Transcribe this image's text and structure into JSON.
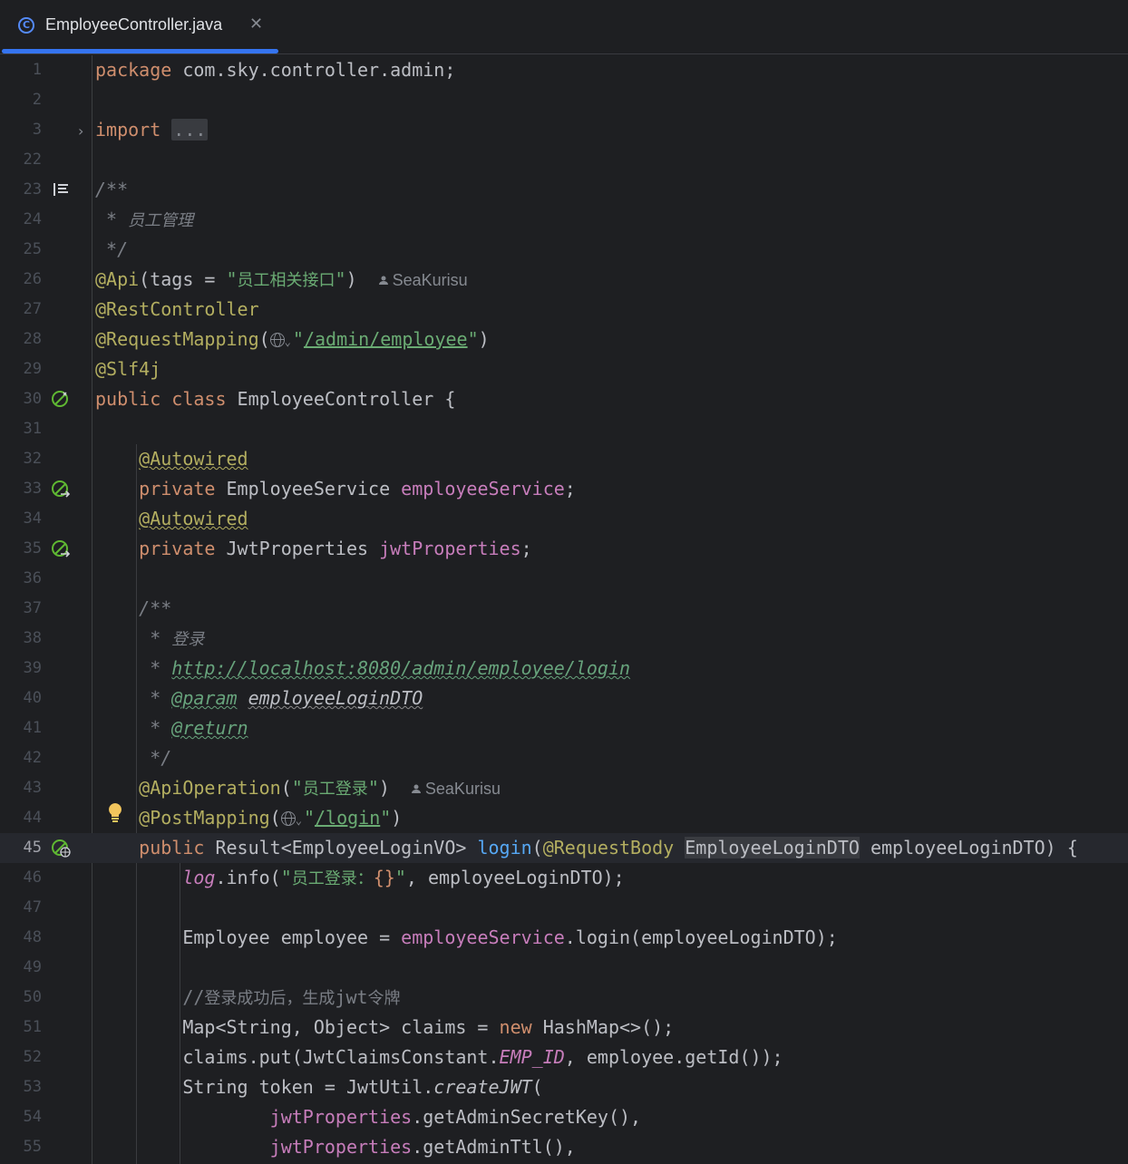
{
  "tab": {
    "icon": "class-icon",
    "label": "EmployeeController.java",
    "close": "✕"
  },
  "author": "SeaKurisu",
  "current_line": 45,
  "lines": [
    {
      "n": "1",
      "html": "<span class=\"kw\">package</span> com.sky.controller.admin;"
    },
    {
      "n": "2",
      "html": ""
    },
    {
      "n": "3",
      "html": "<span class=\"kw\">import</span> <span class=\"fold\">...</span>",
      "fold": true
    },
    {
      "n": "22",
      "html": ""
    },
    {
      "n": "23",
      "html": "<span class=\"cmt\">/**</span>",
      "icon": "reader-mode-icon"
    },
    {
      "n": "24",
      "html": "<span class=\"cmt\"> * <span class=\"cjk\">员工管理</span></span>"
    },
    {
      "n": "25",
      "html": "<span class=\"cmt\"> */</span>"
    },
    {
      "n": "26",
      "html": "<span class=\"ann\">@Api</span>(tags = <span class=\"str\">\"<span class=\"cjk\">员工相关接口</span>\"</span>)",
      "author": true
    },
    {
      "n": "27",
      "html": "<span class=\"ann\">@RestController</span>"
    },
    {
      "n": "28",
      "html": "<span class=\"ann\">@RequestMapping</span>(<span class=\"globe\"></span><span class=\"chev\">⌄</span><span class=\"str\">\"<span class=\"link\">/admin/employee</span>\"</span>)"
    },
    {
      "n": "29",
      "html": "<span class=\"ann\">@Slf4j</span>"
    },
    {
      "n": "30",
      "html": "<span class=\"kw\">public class</span> EmployeeController {",
      "icon": "spring-bean-icon"
    },
    {
      "n": "31",
      "html": ""
    },
    {
      "n": "32",
      "html": "    <span class=\"ann wavy\">@Autowired</span>"
    },
    {
      "n": "33",
      "html": "    <span class=\"kw\">private</span> EmployeeService <span class=\"fld\">employeeService</span>;",
      "icon": "spring-autowired-icon"
    },
    {
      "n": "34",
      "html": "    <span class=\"ann wavy\">@Autowired</span>"
    },
    {
      "n": "35",
      "html": "    <span class=\"kw\">private</span> JwtProperties <span class=\"fld\">jwtProperties</span>;",
      "icon": "spring-autowired-icon"
    },
    {
      "n": "36",
      "html": ""
    },
    {
      "n": "37",
      "html": "    <span class=\"cmt\">/**</span>"
    },
    {
      "n": "38",
      "html": "<span class=\"cmt\">     * <span class=\"cjk\">登录</span></span>"
    },
    {
      "n": "39",
      "html": "<span class=\"cmt\">     * <span class=\"doctag\">http://localhost:8080/admin/employee/login</span></span>"
    },
    {
      "n": "40",
      "html": "<span class=\"cmt\">     * <span class=\"doctag\">@param</span> <span class=\"docref\">employeeLoginDTO</span></span>"
    },
    {
      "n": "41",
      "html": "<span class=\"cmt\">     * <span class=\"doctag\">@return</span></span>"
    },
    {
      "n": "42",
      "html": "<span class=\"cmt\">     */</span>"
    },
    {
      "n": "43",
      "html": "    <span class=\"ann\">@ApiOperation</span>(<span class=\"str\">\"<span class=\"cjk\">员工登录</span>\"</span>)",
      "author": true
    },
    {
      "n": "44",
      "html": "    <span class=\"ann\">@PostMapping</span>(<span class=\"globe\"></span><span class=\"chev\">⌄</span><span class=\"str\">\"<span class=\"link\">/login</span>\"</span>)",
      "bulb": true
    },
    {
      "n": "45",
      "html": "    <span class=\"kw\">public</span> Result&lt;EmployeeLoginVO&gt; <span class=\"fn\">login</span>(<span class=\"ann\">@RequestBody</span> <span class=\"hl\">EmployeeLoginDTO</span> employeeLoginDTO) {",
      "icon": "spring-endpoint-icon"
    },
    {
      "n": "46",
      "html": "        <span class=\"fld ital\">log</span>.info(<span class=\"str\">\"<span class=\"cjk\">员工登录：</span><span class=\"kw\">{}</span>\"</span>, employeeLoginDTO);"
    },
    {
      "n": "47",
      "html": ""
    },
    {
      "n": "48",
      "html": "        Employee employee = <span class=\"fld\">employeeService</span>.login(employeeLoginDTO);"
    },
    {
      "n": "49",
      "html": ""
    },
    {
      "n": "50",
      "html": "        <span class=\"lc\">//<span class=\"cjk\">登录成功后，生成</span>jwt<span class=\"cjk\">令牌</span></span>"
    },
    {
      "n": "51",
      "html": "        Map&lt;String, Object&gt; claims = <span class=\"kw\">new</span> HashMap&lt;&gt;();"
    },
    {
      "n": "52",
      "html": "        claims.put(JwtClaimsConstant.<span class=\"const\">EMP_ID</span>, employee.getId());"
    },
    {
      "n": "53",
      "html": "        String token = JwtUtil.<span class=\"ital\">createJWT</span>("
    },
    {
      "n": "54",
      "html": "                <span class=\"fld\">jwtProperties</span>.getAdminSecretKey(),"
    },
    {
      "n": "55",
      "html": "                <span class=\"fld\">jwtProperties</span>.getAdminTtl(),"
    }
  ]
}
